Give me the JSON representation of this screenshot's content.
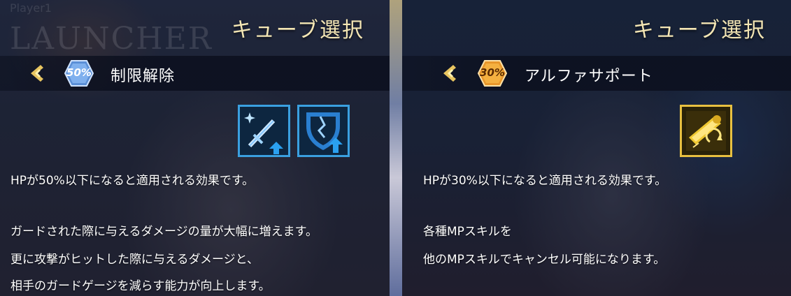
{
  "left": {
    "watermark_player": "Player1",
    "watermark_launcher": "LAUNCHER",
    "title": "キューブ選択",
    "badge_text": "50%",
    "badge_color": "#5b8fd6",
    "cube_name": "制限解除",
    "icons": [
      "sword-up-icon",
      "broken-shield-up-icon"
    ],
    "lines": [
      "HPが50%以下になると適用される効果です。",
      "ガードされた際に与えるダメージの量が大幅に増えます。",
      "更に攻撃がヒットした際に与えるダメージと、",
      "相手のガードゲージを減らす能力が向上します。"
    ]
  },
  "right": {
    "title": "キューブ選択",
    "badge_text": "30%",
    "badge_color": "#e8962a",
    "cube_name": "アルファサポート",
    "icons": [
      "scroll-cycle-icon"
    ],
    "lines": [
      "HPが30%以下になると適用される効果です。",
      "各種MPスキルを",
      "他のMPスキルでキャンセル可能になります。"
    ]
  }
}
